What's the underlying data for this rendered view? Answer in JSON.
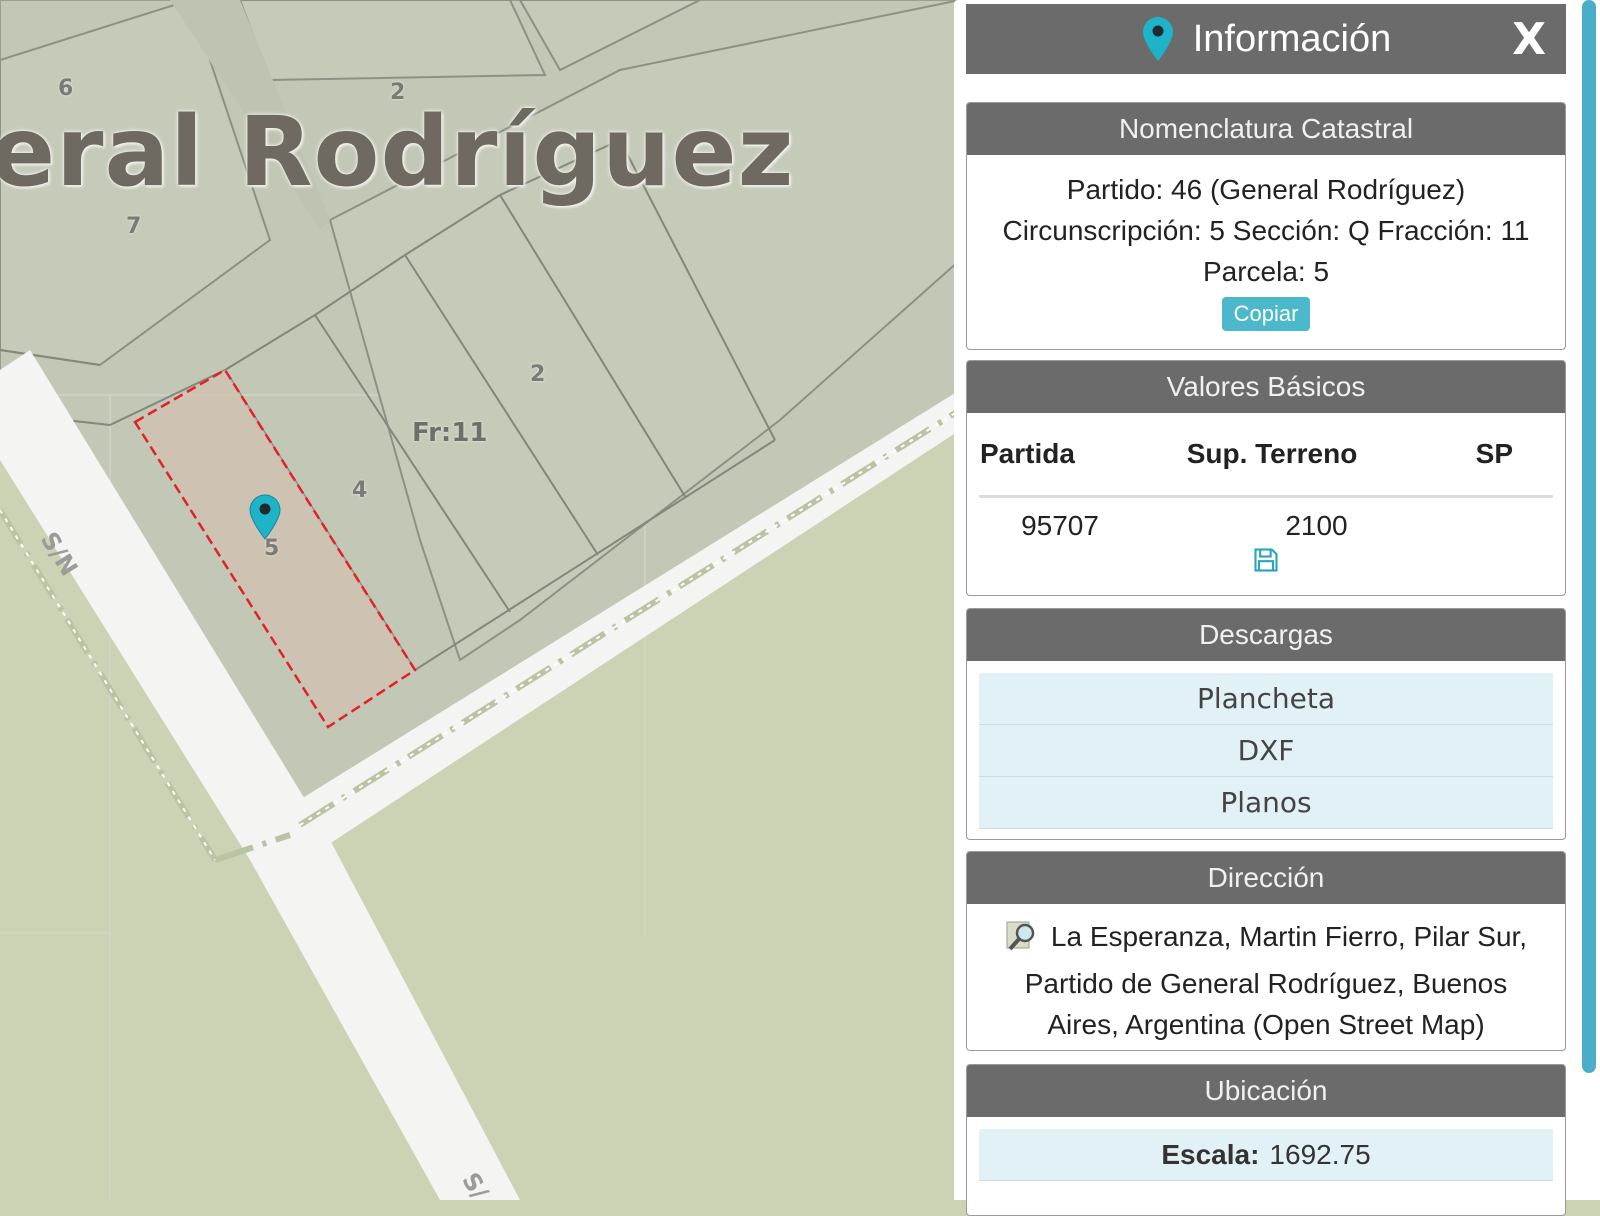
{
  "map": {
    "title": "eral Rodríguez",
    "lot_numbers": [
      "6",
      "2",
      "7",
      "2",
      "4",
      "5"
    ],
    "fraction_label": "Fr:11",
    "road_labels": [
      "S/N",
      "S/"
    ]
  },
  "panel": {
    "header": {
      "title": "Información",
      "close_label": "X"
    },
    "nomenclatura": {
      "title": "Nomenclatura Catastral",
      "line1": "Partido: 46 (General Rodríguez)",
      "line2": "Circunscripción: 5 Sección: Q Fracción: 11",
      "line3": "Parcela: 5",
      "copy_label": "Copiar"
    },
    "valores": {
      "title": "Valores Básicos",
      "columns": [
        "Partida",
        "Sup. Terreno",
        "SP"
      ],
      "row": [
        "95707",
        "2100",
        ""
      ]
    },
    "descargas": {
      "title": "Descargas",
      "items": [
        "Plancheta",
        "DXF",
        "Planos"
      ]
    },
    "direccion": {
      "title": "Dirección",
      "text": "La Esperanza, Martin Fierro, Pilar Sur, Partido de General Rodríguez, Buenos Aires, Argentina (Open Street Map)"
    },
    "ubicacion": {
      "title": "Ubicación",
      "escala_label": "Escala:",
      "escala_value": "1692.75"
    }
  },
  "colors": {
    "accent": "#4cb8cc",
    "header_bg": "#6b6b6b",
    "parcel_highlight": "#e0222a"
  }
}
